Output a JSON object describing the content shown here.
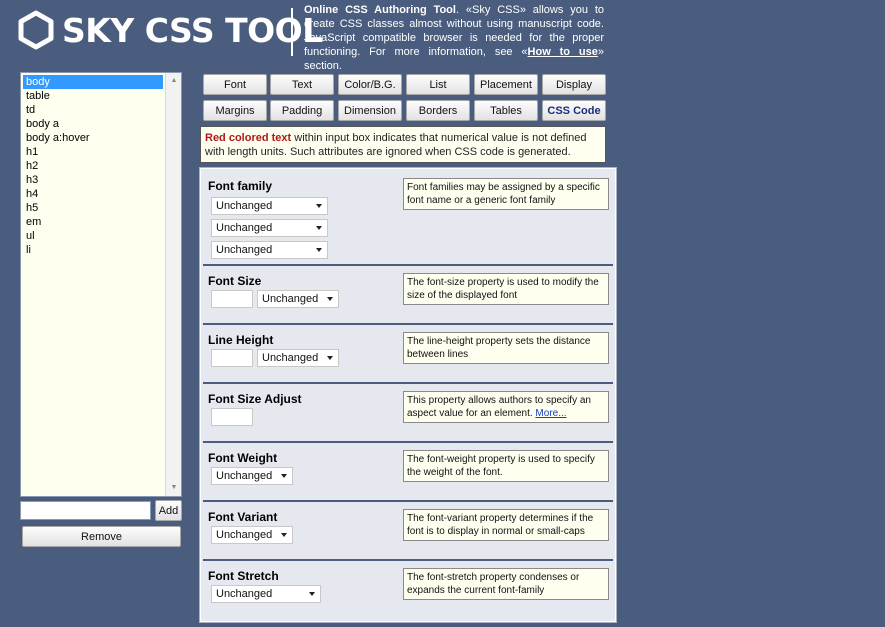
{
  "header": {
    "logo_text": "SKY CSS TOOL",
    "desc_bold": "Online CSS Authoring Tool",
    "desc_text": ". «Sky CSS» allows you to create CSS classes almost without using manuscript code. JavaScript compatible browser is needed for the proper functioning. For more information, see «",
    "desc_link": "How to use",
    "desc_tail": "» section."
  },
  "selectors": {
    "items": [
      "body",
      "table",
      "td",
      "body a",
      "body a:hover",
      "h1",
      "h2",
      "h3",
      "h4",
      "h5",
      "em",
      "ul",
      "li"
    ],
    "selected": "body",
    "new_value": "",
    "add_label": "Add",
    "remove_label": "Remove"
  },
  "tabs": {
    "font": "Font",
    "text": "Text",
    "color": "Color/B.G.",
    "list": "List",
    "placement": "Placement",
    "display": "Display",
    "margins": "Margins",
    "padding": "Padding",
    "dimension": "Dimension",
    "borders": "Borders",
    "tables": "Tables",
    "css_code": "CSS Code"
  },
  "notice": {
    "red": "Red colored text",
    "rest": " within input box indicates that numerical value is not defined with length units. Such attributes are ignored when CSS code is generated."
  },
  "sections": {
    "family": {
      "title": "Font family",
      "hint": "Font families may be assigned by a specific font name or a generic font family",
      "select1": "Unchanged",
      "select2": "Unchanged",
      "select3": "Unchanged"
    },
    "size": {
      "title": "Font Size",
      "hint": "The font-size property is used to modify the size of the displayed font",
      "unit": "Unchanged"
    },
    "line_height": {
      "title": "Line Height",
      "hint": "The line-height property sets the distance between lines",
      "unit": "Unchanged"
    },
    "size_adjust": {
      "title": "Font Size Adjust",
      "hint": "This property allows authors to specify an aspect value for an element. ",
      "hint_link": "More..."
    },
    "weight": {
      "title": "Font Weight",
      "hint": "The font-weight property is used to specify the weight of the font.",
      "value": "Unchanged"
    },
    "variant": {
      "title": "Font Variant",
      "hint": "The font-variant property determines if the font is to display in normal or small-caps",
      "value": "Unchanged"
    },
    "stretch": {
      "title": "Font Stretch",
      "hint": "The font-stretch property condenses or expands the current font-family",
      "value": "Unchanged"
    }
  },
  "colors": {
    "background": "#4a5d7e",
    "panel": "#e5e9ef",
    "note_bg": "#fffff0",
    "selected": "#3399ff",
    "red_text": "#b01818"
  }
}
